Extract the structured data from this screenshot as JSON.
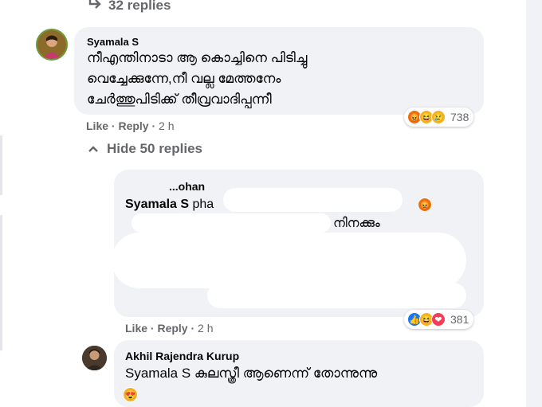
{
  "thread": {
    "top_replies_label": "32 replies",
    "hide_replies_label": "Hide 50 replies"
  },
  "comments": [
    {
      "author": "Syamala S",
      "text_lines": [
        "നീഎന്തിനാടാ ആ കൊച്ചിനെ പിടിച്ചു",
        "വെച്ചേക്കുന്നേ,നീ വല്ല മേത്തനേം",
        "ചേർത്തുപിടിക്ക് തീവ്രവാദിപ്പന്നീ"
      ],
      "like_label": "Like",
      "reply_label": "Reply",
      "time": "2 h",
      "reactions": [
        "angry",
        "haha",
        "sad"
      ],
      "reaction_count": "738"
    },
    {
      "author_partial": "...ohan",
      "text_line1": "Syamala S pha",
      "text_line2": "നിനക്കും",
      "like_label": "Like",
      "reply_label": "Reply",
      "time": "2 h",
      "reactions": [
        "like",
        "haha",
        "love"
      ],
      "reaction_count": "381"
    },
    {
      "author": "Akhil Rajendra Kurup",
      "text": "Syamala S കുലസ്ത്രീ ആണെന്ന് തോന്നുന്നു"
    }
  ],
  "icons": {
    "reply_arrow": "reply-arrow-icon",
    "chevron_up": "chevron-up-icon"
  }
}
